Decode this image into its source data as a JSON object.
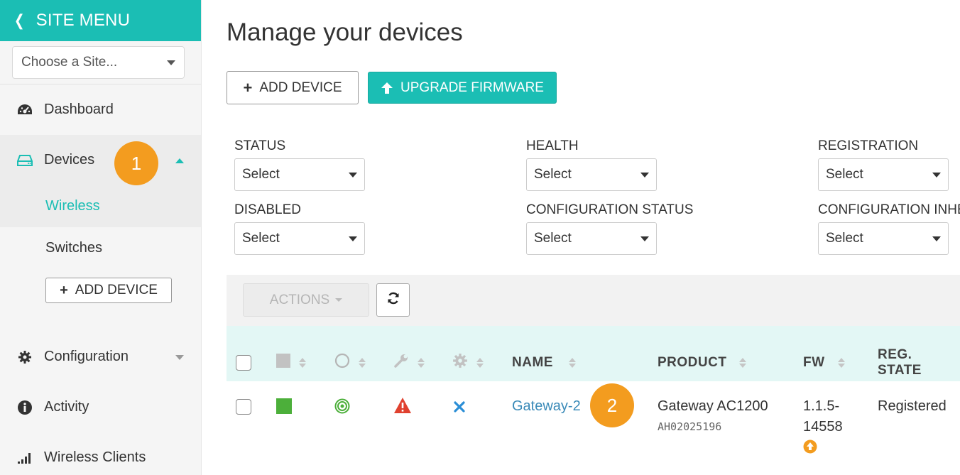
{
  "sidebar": {
    "header": "SITE MENU",
    "site_select_placeholder": "Choose a Site...",
    "items": [
      {
        "label": "Dashboard",
        "icon": "dashboard-icon"
      },
      {
        "label": "Devices",
        "icon": "device-icon",
        "expanded": true
      },
      {
        "label": "Configuration",
        "icon": "gear-icon"
      },
      {
        "label": "Activity",
        "icon": "info-icon"
      },
      {
        "label": "Wireless Clients",
        "icon": "signal-bars-icon"
      }
    ],
    "devices_sub": [
      {
        "label": "Wireless",
        "active": true
      },
      {
        "label": "Switches",
        "active": false
      }
    ],
    "add_device_label": "ADD DEVICE"
  },
  "main": {
    "title": "Manage your devices",
    "add_device_label": "ADD DEVICE",
    "upgrade_firmware_label": "UPGRADE FIRMWARE",
    "filters": [
      {
        "label": "STATUS",
        "value": "Select"
      },
      {
        "label": "HEALTH",
        "value": "Select"
      },
      {
        "label": "REGISTRATION",
        "value": "Select"
      },
      {
        "label": "DISABLED",
        "value": "Select"
      },
      {
        "label": "CONFIGURATION STATUS",
        "value": "Select"
      },
      {
        "label": "CONFIGURATION INHE",
        "value": "Select"
      }
    ],
    "actions_label": "ACTIONS",
    "table": {
      "columns": [
        "NAME",
        "PRODUCT",
        "FW",
        "REG. STATE"
      ],
      "rows": [
        {
          "name": "Gateway-2",
          "product": "Gateway AC1200",
          "serial": "AH02025196",
          "fw_line1": "1.1.5-",
          "fw_line2": "14558",
          "reg_state": "Registered"
        }
      ]
    }
  },
  "callouts": {
    "one": "1",
    "two": "2"
  },
  "colors": {
    "accent": "#1bbeb4",
    "callout": "#f39c1f",
    "link": "#3a8ab8",
    "status_green": "#4caf3a",
    "warning_red": "#e0412f",
    "disabled_blue": "#2b8ed6"
  }
}
